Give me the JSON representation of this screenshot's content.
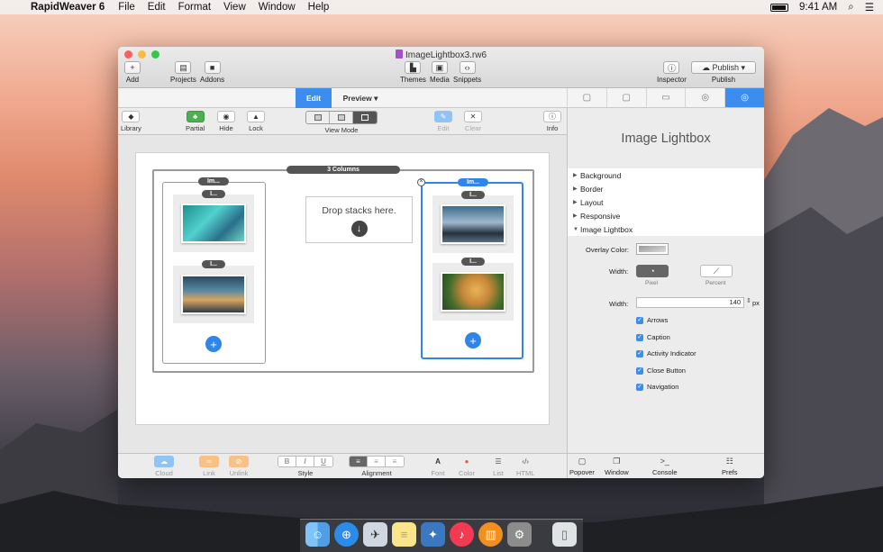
{
  "menubar": {
    "app": "RapidWeaver 6",
    "items": [
      "File",
      "Edit",
      "Format",
      "View",
      "Window",
      "Help"
    ],
    "time": "9:41 AM"
  },
  "window": {
    "title": "ImageLightbox3.rw6",
    "toolbar": {
      "add": "Add",
      "projects": "Projects",
      "addons": "Addons",
      "themes": "Themes",
      "media": "Media",
      "snippets": "Snippets",
      "inspector": "Inspector",
      "publish_btn": "Publish",
      "publish": "Publish"
    },
    "modes": {
      "edit": "Edit",
      "preview": "Preview"
    },
    "tool2": {
      "library": "Library",
      "partial": "Partial",
      "hide": "Hide",
      "lock": "Lock",
      "view_mode": "View Mode",
      "edit": "Edit",
      "clear": "Clear",
      "info": "Info"
    },
    "canvas": {
      "columns_label": "3 Columns",
      "col1_label": "Im...",
      "col3_label": "Im...",
      "item_label": "I...",
      "drop_text": "Drop stacks here."
    },
    "bottom": {
      "cloud": "Cloud",
      "link": "Link",
      "unlink": "Unlink",
      "style": "Style",
      "alignment": "Alignment",
      "font": "Font",
      "color": "Color",
      "list": "List",
      "html": "HTML",
      "b": "B",
      "i": "I",
      "u": "U"
    },
    "panel": {
      "title": "Image Lightbox",
      "sections": [
        "Background",
        "Border",
        "Layout",
        "Responsive",
        "Image Lightbox"
      ],
      "overlay_color_label": "Overlay Color:",
      "width_label": "Width:",
      "pixel": "Pixel",
      "percent": "Percent",
      "width2_label": "Width:",
      "width_value": "140",
      "width_unit": "px",
      "checks": [
        "Arrows",
        "Caption",
        "Activity Indicator",
        "Close Button",
        "Navigation"
      ],
      "footer": {
        "popover": "Popover",
        "window": "Window",
        "console": "Console",
        "prefs": "Prefs"
      }
    }
  },
  "colors": {
    "accent": "#3b8ef0",
    "partial_green": "#4caf50"
  }
}
